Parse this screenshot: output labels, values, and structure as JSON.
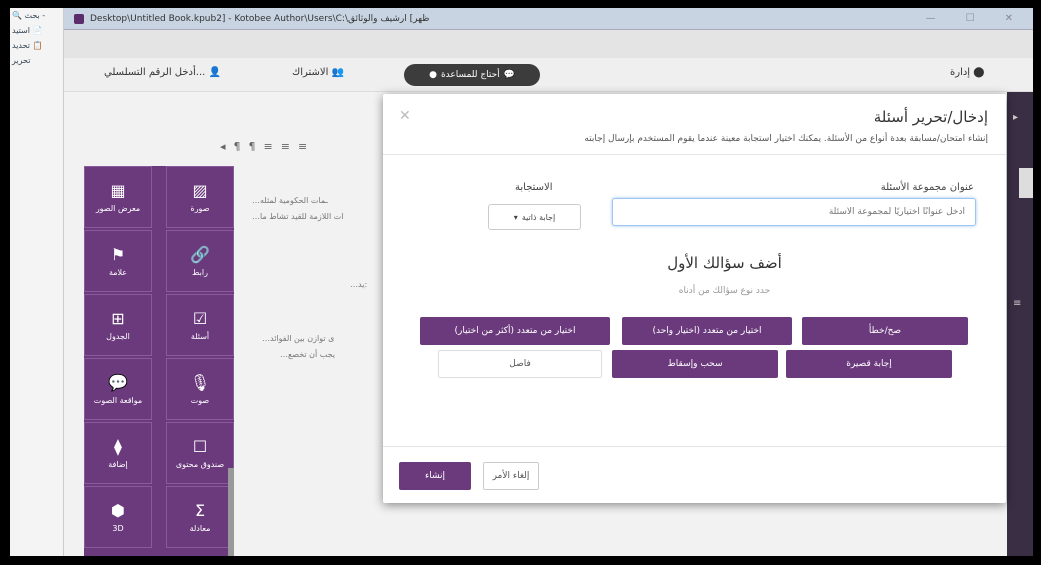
{
  "window": {
    "title": "Desktop\\Untitled Book.kpub2] - Kotobee Author\\Users\\C:\\ظهر] ارشيف والوثائق"
  },
  "left_toolbar": {
    "items": [
      "🔍 بحث -",
      "استيد 📄",
      "تحديد 📋",
      "تحرير"
    ]
  },
  "menu": {
    "serial_label": "أدخل الرقم التسلسلي...",
    "subscription_label": "الاشتراك",
    "manage_label": "إدارة",
    "active_tab_label": "أحتاج للمساعدة"
  },
  "palette": {
    "tiles": [
      {
        "label": "صورة",
        "icon": "image-icon",
        "glyph": "▨"
      },
      {
        "label": "معرض الصور",
        "icon": "gallery-icon",
        "glyph": "▦"
      },
      {
        "label": "رابط",
        "icon": "link-icon",
        "glyph": "🔗"
      },
      {
        "label": "علامة",
        "icon": "flag-icon",
        "glyph": "⚑"
      },
      {
        "label": "أسئلة",
        "icon": "checkbox-icon",
        "glyph": "☑"
      },
      {
        "label": "الجدول",
        "icon": "table-icon",
        "glyph": "⊞"
      },
      {
        "label": "صوت",
        "icon": "microphone-icon",
        "glyph": "🎙"
      },
      {
        "label": "مواقعة الصوت",
        "icon": "chat-icon",
        "glyph": "💬"
      },
      {
        "label": "صندوق محتوى",
        "icon": "box-icon",
        "glyph": "☐"
      },
      {
        "label": "إضافة",
        "icon": "puzzle-icon",
        "glyph": "⧫"
      },
      {
        "label": "معادلة",
        "icon": "sigma-icon",
        "glyph": "Σ"
      },
      {
        "label": "3D",
        "icon": "cube-icon",
        "glyph": "⬢"
      }
    ]
  },
  "doc_text": [
    "…ـمات الحكومية لمثله",
    "…ات اللازمة للقيد تشاط ما",
    "…يد:",
    "…ى توازن بين الفوائد",
    "…يجب أن تخصع"
  ],
  "modal": {
    "title": "إدخال/تحرير أسئلة",
    "description": "إنشاء امتحان/مسابقة بعدة أنواع من الأسئلة. يمكنك اختيار استجابة معينة عندما يقوم المستخدم بإرسال إجابته",
    "group_title_label": "عنوان مجموعة الأسئلة",
    "group_title_placeholder": "أدخل عنوانًا اختياريًا لمجموعة الأسئلة",
    "response_label": "الاستجابة",
    "response_value": "إجابة ذاتية",
    "heading": "أضف سؤالك الأول",
    "subheading": "حدد نوع سؤالك من أدناه",
    "question_types": [
      "صح/خطأ",
      "اختيار من متعدد (اختيار واحد)",
      "اختيار من متعدد (أكثر من اختيار)",
      "إجابة قصيرة",
      "سحب وإسقاط",
      "فاصل"
    ],
    "create_label": "إنشاء",
    "cancel_label": "إلغاء الأمر"
  }
}
